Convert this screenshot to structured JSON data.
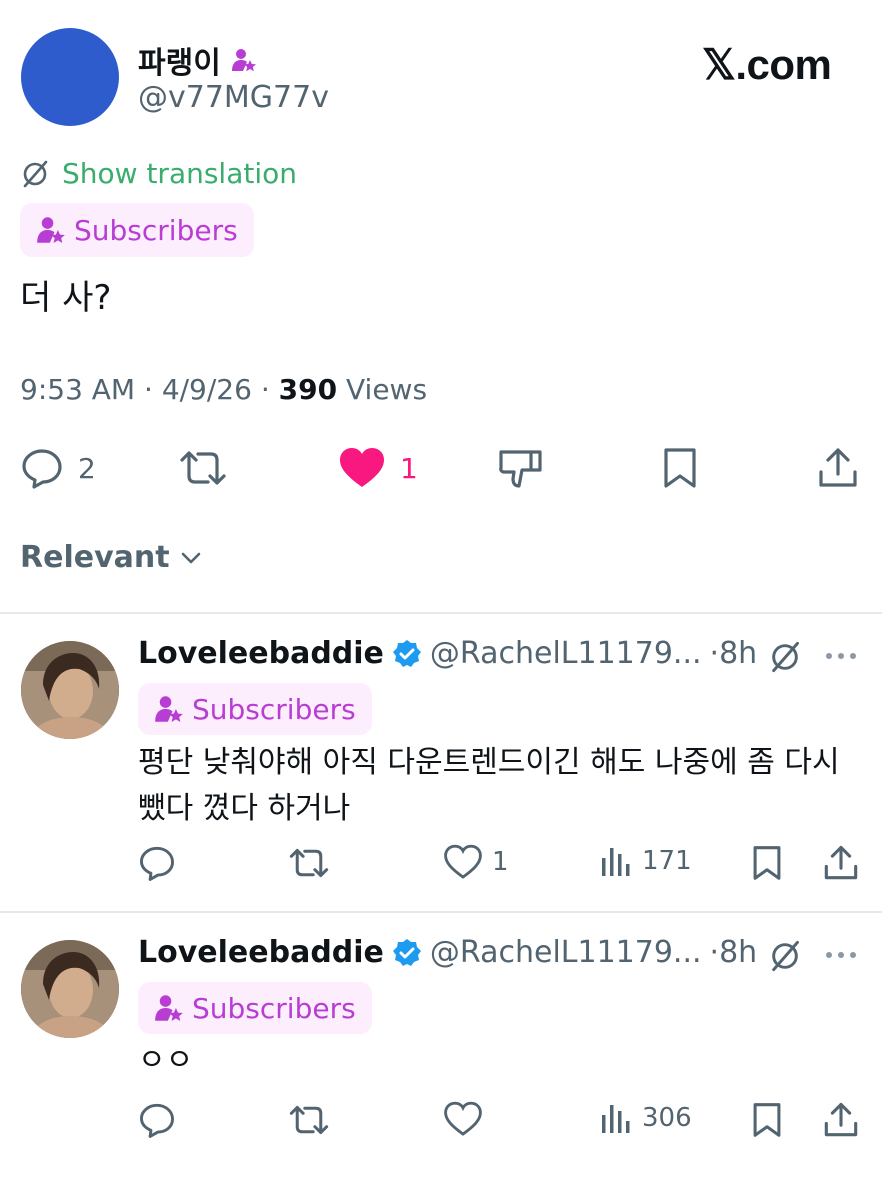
{
  "post": {
    "author_name": "파랭이",
    "author_handle": "@v77MG77v",
    "brand": "𝕏.com",
    "translate_label": "Show translation",
    "badge_label": "Subscribers",
    "text": "더 사?",
    "time": "9:53 AM",
    "separator": "·",
    "date": "4/9/26",
    "views_count": "390",
    "views_label": "Views",
    "reply_count": "2",
    "like_count": "1",
    "like_color": "#f91880"
  },
  "sort": {
    "label": "Relevant"
  },
  "replies": [
    {
      "name": "Loveleebaddie",
      "handle": "@RachelL11179...",
      "time": "·8h",
      "badge": "Subscribers",
      "text": "평단 낮춰야해 아직 다운트렌드이긴 해도 나중에 좀 다시 뺐다 꼈다 하거나",
      "likes": "1",
      "views": "171"
    },
    {
      "name": "Loveleebaddie",
      "handle": "@RachelL11179...",
      "time": "·8h",
      "badge": "Subscribers",
      "text": "ㅇㅇ",
      "likes": "",
      "views": "306"
    }
  ],
  "colors": {
    "accent_purple": "#b83ed3",
    "translate_green": "#3aad6d",
    "verified_blue": "#1d9bf0"
  }
}
